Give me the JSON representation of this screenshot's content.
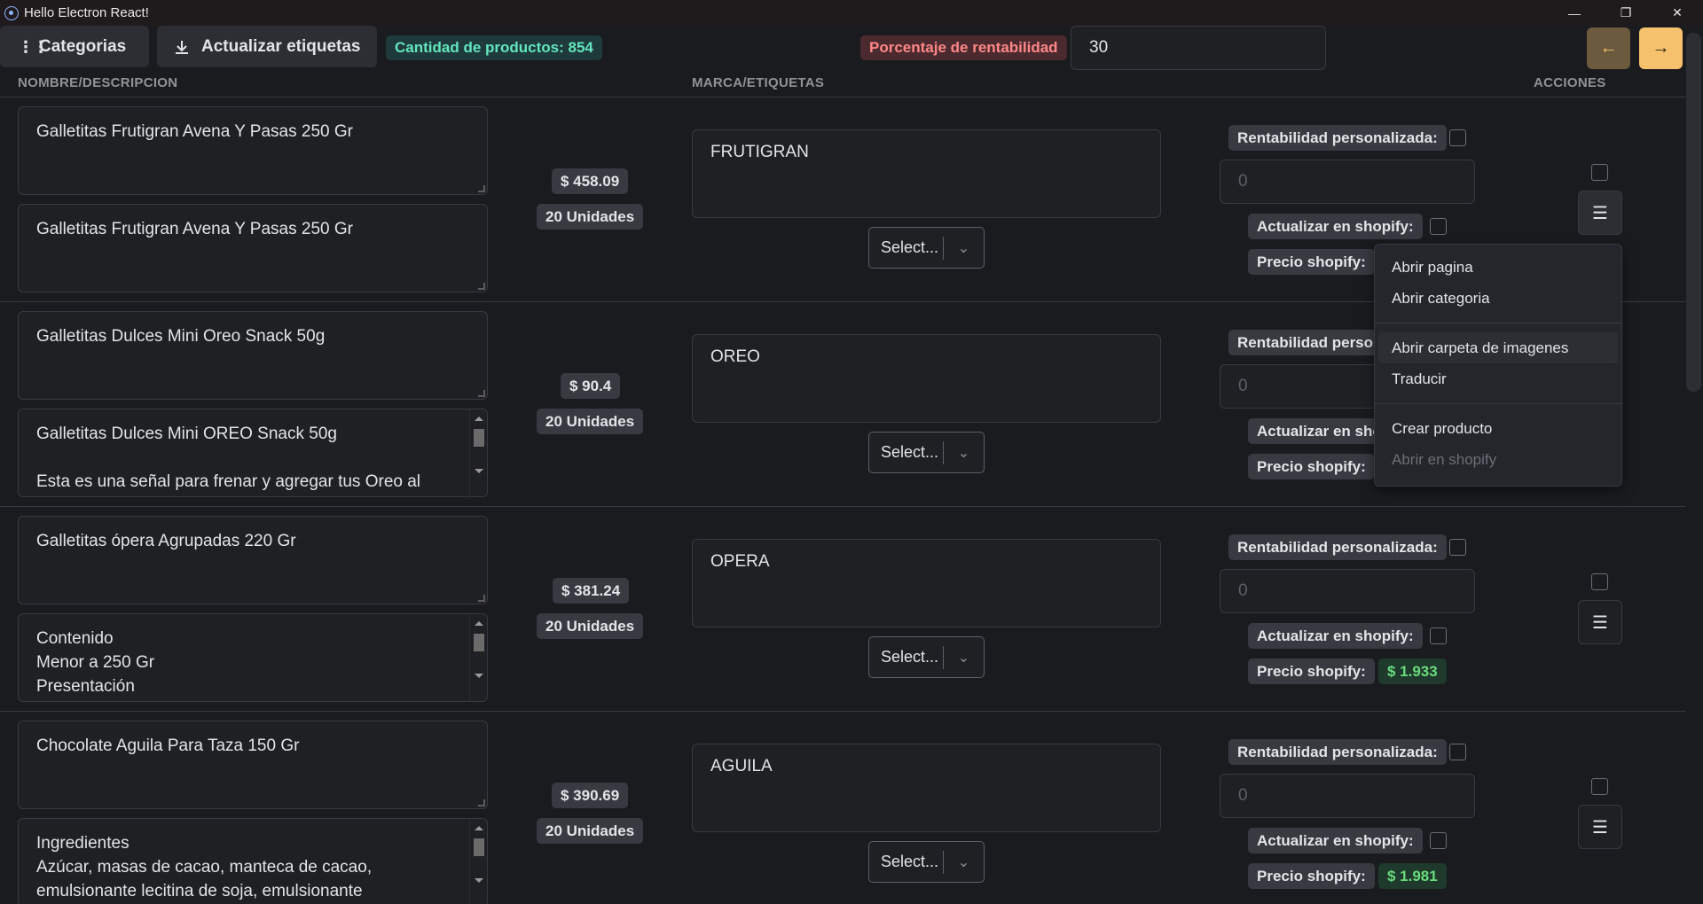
{
  "window": {
    "title": "Hello Electron React!"
  },
  "toolbar": {
    "categorias_label": "Categorias",
    "actualizar_label": "Actualizar etiquetas",
    "count_label": "Cantidad de productos: 854",
    "rentabilidad_label": "Porcentaje de rentabilidad",
    "rentabilidad_value": "30"
  },
  "headers": {
    "nombre": "NOMBRE/DESCRIPCION",
    "marca": "MARCA/ETIQUETAS",
    "acciones": "ACCIONES"
  },
  "labels": {
    "rent_personalizada": "Rentabilidad personalizada:",
    "actualizar_shopify": "Actualizar en shopify:",
    "precio_shopify": "Precio shopify:",
    "select_placeholder": "Select...",
    "rent_placeholder": "0"
  },
  "products": [
    {
      "name": "Galletitas Frutigran Avena Y Pasas 250 Gr",
      "description": "Galletitas Frutigran Avena Y Pasas 250 Gr",
      "price": "$ 458.09",
      "units": "20 Unidades",
      "brand": "FRUTIGRAN",
      "shopify_price": ""
    },
    {
      "name": "Galletitas Dulces Mini Oreo Snack 50g",
      "description": "Galletitas Dulces Mini OREO Snack 50g\n\nEsta es una señal para frenar y agregar tus Oreo al",
      "price": "$ 90.4",
      "units": "20 Unidades",
      "brand": "OREO",
      "shopify_price": ""
    },
    {
      "name": "Galletitas ópera Agrupadas 220 Gr",
      "description": "Contenido\nMenor a 250 Gr\nPresentación",
      "price": "$ 381.24",
      "units": "20 Unidades",
      "brand": "OPERA",
      "shopify_price": "$ 1.933"
    },
    {
      "name": "Chocolate Aguila Para Taza 150 Gr",
      "description": "Ingredientes\nAzúcar, masas de cacao, manteca de cacao,\nemulsionante lecitina de soja, emulsionante",
      "price": "$ 390.69",
      "units": "20 Unidades",
      "brand": "AGUILA",
      "shopify_price": "$ 1.981"
    }
  ],
  "context_menu": {
    "items": [
      "Abrir pagina",
      "Abrir categoria",
      "Abrir carpeta de imagenes",
      "Traducir",
      "Crear producto",
      "Abrir en shopify"
    ]
  }
}
